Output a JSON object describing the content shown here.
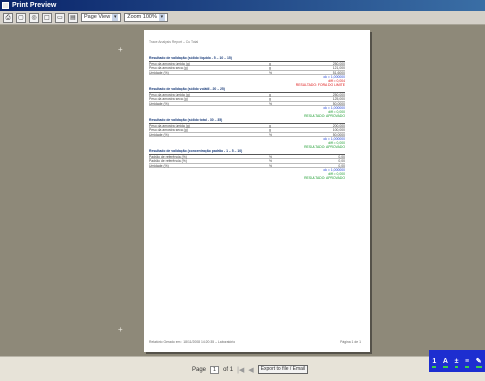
{
  "window": {
    "title": "Print Preview"
  },
  "toolbar": {
    "buttons": [
      {
        "name": "print-icon",
        "glyph": "⎙"
      },
      {
        "name": "fit-page-icon",
        "glyph": "▢"
      },
      {
        "name": "zoom-icon",
        "glyph": "◎"
      },
      {
        "name": "single-page-icon",
        "glyph": "□"
      },
      {
        "name": "two-page-icon",
        "glyph": "▭"
      },
      {
        "name": "multi-page-icon",
        "glyph": "▤"
      }
    ],
    "view_select": "Page View",
    "zoom_select": "Zoom 100%"
  },
  "report": {
    "header": "Trace Analysis Report – Cu Total",
    "sections": [
      {
        "title": "Resultado de validação (sólido líquido - 5 – 10 – 15)",
        "rows": [
          {
            "label": "Peso da amostra úmida (g)",
            "unit": "g",
            "value": "250,000"
          },
          {
            "label": "Peso da amostra seca (g)",
            "unit": "g",
            "value": "121,000"
          },
          {
            "label": "Umidade (%)",
            "unit": "%",
            "value": "51,6000"
          }
        ],
        "summary": [
          {
            "text": "ok = 1,000000",
            "color": "blue"
          },
          {
            "text": "diff = 0,004",
            "color": "red"
          },
          {
            "text": "RESULTADO: FORA DO LIMITE",
            "color": "red"
          }
        ]
      },
      {
        "title": "Resultado de validação (sólido volátil - 20 – 25)",
        "rows": [
          {
            "label": "Peso da amostra úmida (g)",
            "unit": "g",
            "value": "250,000"
          },
          {
            "label": "Peso da amostra seca (g)",
            "unit": "g",
            "value": "125,000"
          },
          {
            "label": "Umidade (%)",
            "unit": "%",
            "value": "50,0000"
          }
        ],
        "summary": [
          {
            "text": "ok = 1,000000",
            "color": "blue"
          },
          {
            "text": "diff = 0,000",
            "color": "green"
          },
          {
            "text": "RESULTADO: APROVADO",
            "color": "green"
          }
        ]
      },
      {
        "title": "Resultado de validação (sólido total - 30 – 35)",
        "rows": [
          {
            "label": "Peso da amostra úmida (g)",
            "unit": "g",
            "value": "200,000"
          },
          {
            "label": "Peso da amostra seca (g)",
            "unit": "g",
            "value": "100,000"
          },
          {
            "label": "Umidade (%)",
            "unit": "%",
            "value": "50,0000"
          }
        ],
        "summary": [
          {
            "text": "ok = 1,000000",
            "color": "blue"
          },
          {
            "text": "diff = 0,000",
            "color": "green"
          },
          {
            "text": "RESULTADO: APROVADO",
            "color": "green"
          }
        ]
      },
      {
        "title": "Resultado de validação (concentração padrão - 1 – 5 – 10)",
        "rows": [
          {
            "label": "Padrão de referência (%)",
            "unit": "%",
            "value": "0,00"
          },
          {
            "label": "Padrão de referência (%)",
            "unit": "%",
            "value": "0,00"
          },
          {
            "label": "Umidade (%)",
            "unit": "%",
            "value": "0,00"
          }
        ],
        "summary": [
          {
            "text": "ok = 1,000000",
            "color": "blue"
          },
          {
            "text": "diff = 0,000",
            "color": "green"
          },
          {
            "text": "RESULTADO: APROVADO",
            "color": "green"
          }
        ]
      }
    ],
    "footer_left": "Relatório Gerado em : 18/11/2008 14:20:35 – Laboratório",
    "footer_right": "Página 1 de 1"
  },
  "statusbar": {
    "page_label": "Page",
    "page_value": "1",
    "page_of": "of 1",
    "first_glyph": "|◀",
    "prev_glyph": "◀",
    "export_label": "Export to file / Email"
  },
  "right_tools": [
    "1",
    "A",
    "±",
    "≡",
    "✎"
  ]
}
